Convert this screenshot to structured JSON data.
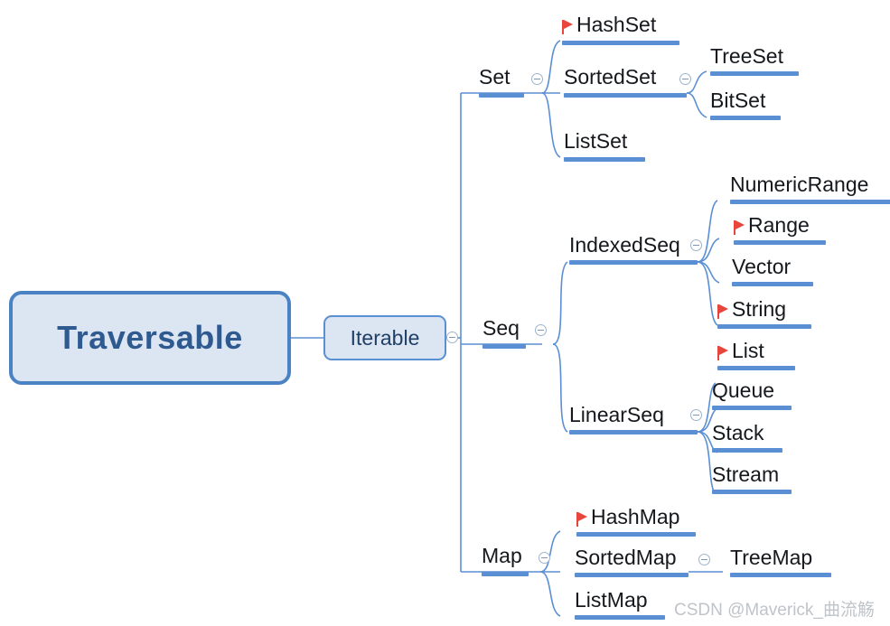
{
  "diagram": {
    "title": "Traversable",
    "watermark": "CSDN @Maverick_曲流觞",
    "colors": {
      "line": "#5b8fd4",
      "bar": "#5b8fd4",
      "box_fill": "#dce5f2",
      "box_border": "#4b82c3",
      "root_text": "#2f5a8f",
      "node_text": "#15181c",
      "flag": "#e8453c",
      "toggle": "#9db3cc",
      "watermark": "#bfc4c9",
      "background": "#ffffff"
    },
    "root": {
      "label": "Traversable"
    },
    "iterable": {
      "label": "Iterable"
    },
    "branches": {
      "set": {
        "label": "Set"
      },
      "seq": {
        "label": "Seq"
      },
      "map": {
        "label": "Map"
      }
    },
    "nodes": {
      "hashset": {
        "label": "HashSet",
        "flag": true
      },
      "sortedset": {
        "label": "SortedSet",
        "flag": false
      },
      "listset": {
        "label": "ListSet",
        "flag": false
      },
      "treeset": {
        "label": "TreeSet",
        "flag": false
      },
      "bitset": {
        "label": "BitSet",
        "flag": false
      },
      "indexedseq": {
        "label": "IndexedSeq",
        "flag": false
      },
      "numericrange": {
        "label": "NumericRange",
        "flag": false
      },
      "range": {
        "label": "Range",
        "flag": true
      },
      "vector": {
        "label": "Vector",
        "flag": false
      },
      "string": {
        "label": "String",
        "flag": true
      },
      "linearseq": {
        "label": "LinearSeq",
        "flag": false
      },
      "list": {
        "label": "List",
        "flag": true
      },
      "queue": {
        "label": "Queue",
        "flag": false
      },
      "stack": {
        "label": "Stack",
        "flag": false
      },
      "stream": {
        "label": "Stream",
        "flag": false
      },
      "hashmap": {
        "label": "HashMap",
        "flag": true
      },
      "sortedmap": {
        "label": "SortedMap",
        "flag": false
      },
      "listmap": {
        "label": "ListMap",
        "flag": false
      },
      "treemap": {
        "label": "TreeMap",
        "flag": false
      }
    },
    "toggles": {
      "iterable": "collapse",
      "set": "collapse",
      "sortedset": "collapse",
      "seq": "collapse",
      "indexedseq": "collapse",
      "linearseq": "collapse",
      "map": "collapse",
      "sortedmap": "collapse"
    }
  }
}
